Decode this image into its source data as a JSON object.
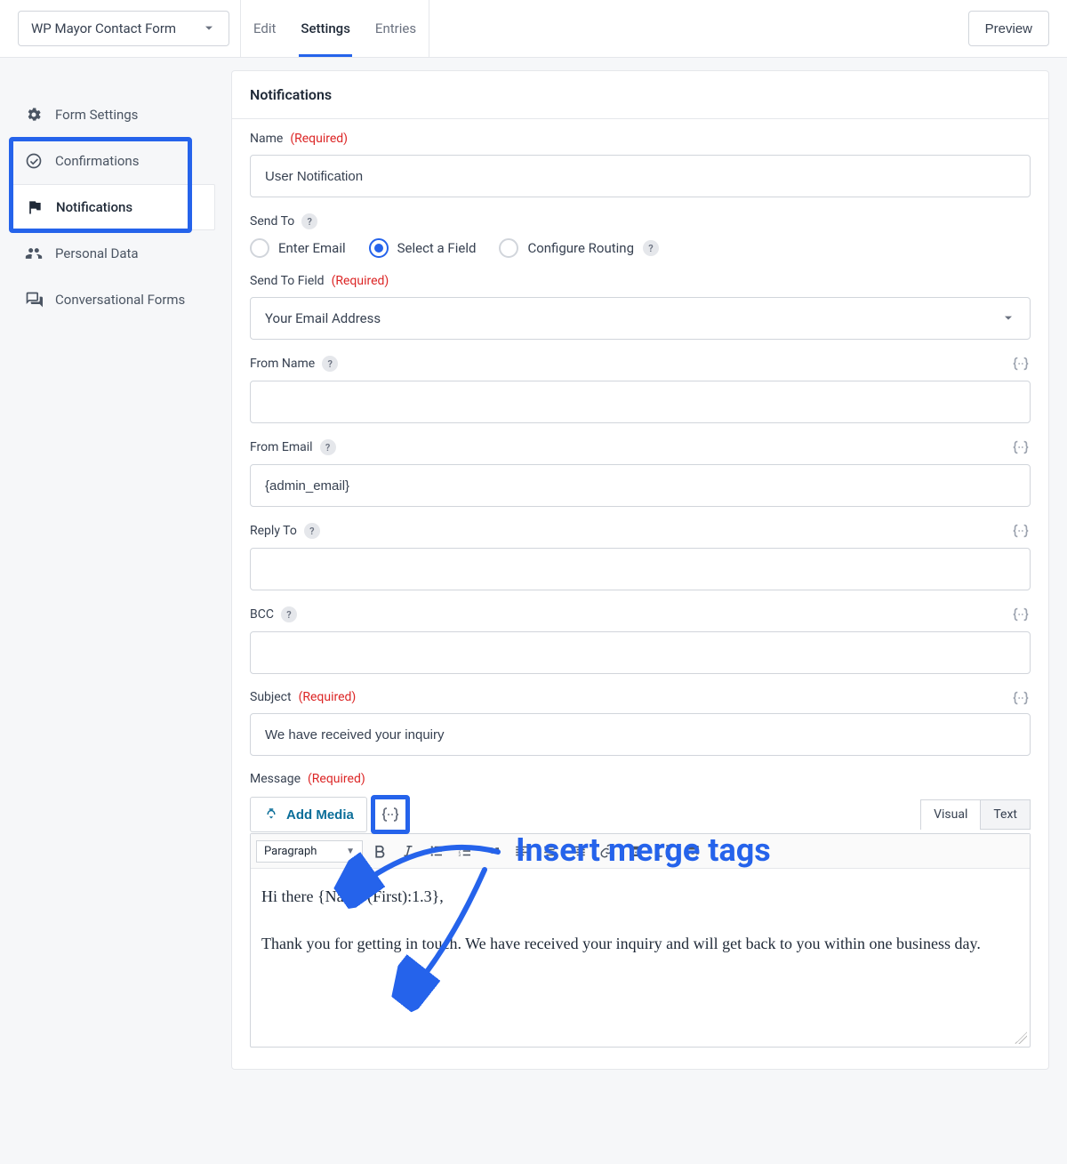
{
  "header": {
    "form_name": "WP Mayor Contact Form",
    "tabs": [
      "Edit",
      "Settings",
      "Entries"
    ],
    "active_tab": "Settings",
    "preview": "Preview"
  },
  "sidebar": {
    "items": [
      {
        "label": "Form Settings",
        "icon": "gear"
      },
      {
        "label": "Confirmations",
        "icon": "check-circle"
      },
      {
        "label": "Notifications",
        "icon": "flag",
        "active": true
      },
      {
        "label": "Personal Data",
        "icon": "people"
      },
      {
        "label": "Conversational Forms",
        "icon": "chat"
      }
    ]
  },
  "panel": {
    "title": "Notifications",
    "name_label": "Name",
    "name_value": "User Notification",
    "sendto_label": "Send To",
    "sendto_options": [
      "Enter Email",
      "Select a Field",
      "Configure Routing"
    ],
    "sendto_selected": "Select a Field",
    "sendtofield_label": "Send To Field",
    "sendtofield_value": "Your Email Address",
    "fromname_label": "From Name",
    "fromname_value": "",
    "fromemail_label": "From Email",
    "fromemail_value": "{admin_email}",
    "replyto_label": "Reply To",
    "replyto_value": "",
    "bcc_label": "BCC",
    "bcc_value": "",
    "subject_label": "Subject",
    "subject_value": "We have received your inquiry",
    "message_label": "Message",
    "add_media": "Add Media",
    "editor_tabs": {
      "visual": "Visual",
      "text": "Text",
      "active": "Visual"
    },
    "paragraph_label": "Paragraph",
    "message_line1": "Hi there {Name (First):1.3},",
    "message_line2": "Thank you for getting in touch. We have received your inquiry and will get back to you within one business day.",
    "required_text": "(Required)"
  },
  "annotation": {
    "text": "Insert merge tags"
  }
}
